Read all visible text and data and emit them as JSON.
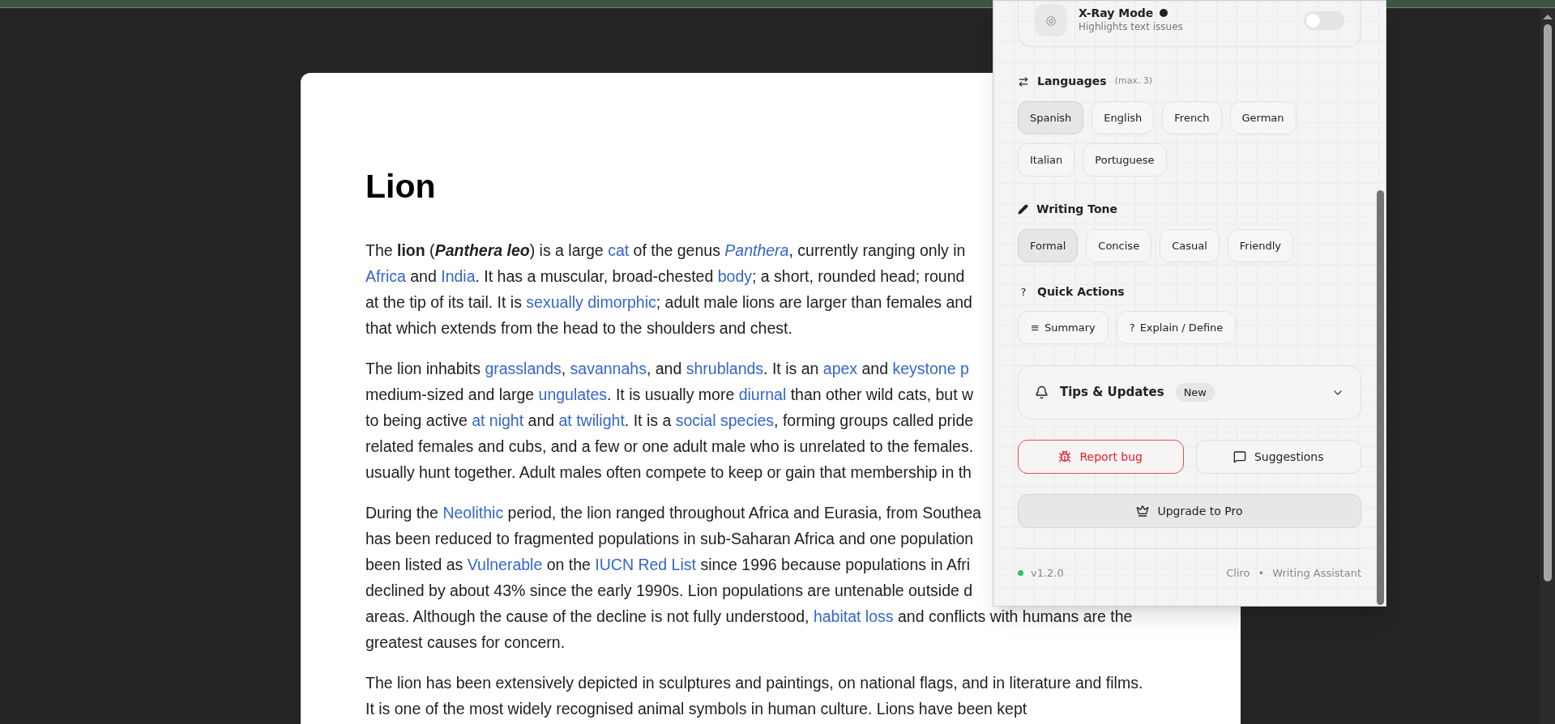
{
  "article": {
    "title": "Lion",
    "paragraphs": [
      {
        "lines": [
          [
            {
              "text": "The **lion** (",
              "link": false
            },
            {
              "text": "*Panthera leo*",
              "link": false,
              "bold": true
            },
            {
              "text": ") is a large ",
              "link": false
            },
            {
              "text": "cat",
              "link": true
            },
            {
              "text": " of the genus ",
              "link": false
            },
            {
              "text": "*Panthera*",
              "link": true
            },
            {
              "text": ", currently ranging only in",
              "link": false
            }
          ],
          [
            {
              "text": "Africa",
              "link": true
            },
            {
              "text": " and ",
              "link": false
            },
            {
              "text": "India",
              "link": true
            },
            {
              "text": ". It has a muscular, broad-chested ",
              "link": false
            },
            {
              "text": "body",
              "link": true
            },
            {
              "text": "; a short, rounded head; round",
              "link": false
            }
          ],
          [
            {
              "text": "at the tip of its tail. It is ",
              "link": false
            },
            {
              "text": "sexually dimorphic",
              "link": true
            },
            {
              "text": "; adult male lions are larger than females and",
              "link": false
            }
          ],
          [
            {
              "text": "that which extends from the head to the shoulders and chest.",
              "link": false
            }
          ]
        ]
      },
      {
        "lines": [
          [
            {
              "text": "The lion inhabits ",
              "link": false
            },
            {
              "text": "grasslands",
              "link": true
            },
            {
              "text": ", ",
              "link": false
            },
            {
              "text": "savannahs",
              "link": true
            },
            {
              "text": ", and ",
              "link": false
            },
            {
              "text": "shrublands",
              "link": true
            },
            {
              "text": ". It is an ",
              "link": false
            },
            {
              "text": "apex",
              "link": true
            },
            {
              "text": " and ",
              "link": false
            },
            {
              "text": "keystone p",
              "link": true
            }
          ],
          [
            {
              "text": "medium-sized and large ",
              "link": false
            },
            {
              "text": "ungulates",
              "link": true
            },
            {
              "text": ". It is usually more ",
              "link": false
            },
            {
              "text": "diurnal",
              "link": true
            },
            {
              "text": " than other wild cats, but w",
              "link": false
            }
          ],
          [
            {
              "text": "to being active ",
              "link": false
            },
            {
              "text": "at night",
              "link": true
            },
            {
              "text": " and ",
              "link": false
            },
            {
              "text": "at twilight",
              "link": true
            },
            {
              "text": ". It is a ",
              "link": false
            },
            {
              "text": "social species",
              "link": true
            },
            {
              "text": ", forming groups called pride",
              "link": false
            }
          ],
          [
            {
              "text": "related females and cubs, and a few or one adult male who is unrelated to the females.",
              "link": false
            }
          ],
          [
            {
              "text": "usually hunt together. Adult males often compete to keep or gain that membership in th",
              "link": false
            }
          ]
        ]
      },
      {
        "lines": [
          [
            {
              "text": "During the ",
              "link": false
            },
            {
              "text": "Neolithic",
              "link": true
            },
            {
              "text": " period, the lion ranged throughout Africa and Eurasia, from Southea",
              "link": false
            }
          ],
          [
            {
              "text": "has been reduced to fragmented populations in sub-Saharan Africa and one population",
              "link": false
            }
          ],
          [
            {
              "text": "been listed as ",
              "link": false
            },
            {
              "text": "Vulnerable",
              "link": true
            },
            {
              "text": " on the ",
              "link": false
            },
            {
              "text": "IUCN Red List",
              "link": true
            },
            {
              "text": " since 1996 because populations in Afri",
              "link": false
            }
          ],
          [
            {
              "text": "declined by about 43% since the early 1990s. Lion populations are untenable outside d",
              "link": false
            }
          ],
          [
            {
              "text": "areas. Although the cause of the decline is not fully understood, ",
              "link": false
            },
            {
              "text": "habitat loss",
              "link": true
            },
            {
              "text": " and conflicts with humans are the",
              "link": false
            }
          ],
          [
            {
              "text": "greatest causes for concern.",
              "link": false
            }
          ]
        ]
      },
      {
        "lines": [
          [
            {
              "text": "The lion has been extensively depicted in sculptures and paintings, on national flags, and in literature and films.",
              "link": false
            }
          ],
          [
            {
              "text": "It is one of the most widely recognised animal symbols in human culture. Lions have been kept",
              "link": false
            }
          ]
        ]
      }
    ]
  },
  "panel": {
    "xray": {
      "icon": "◎",
      "title": "X-Ray Mode",
      "subtitle": "Highlights text issues",
      "on": false
    },
    "languages": {
      "title": "Languages",
      "note": "(max. 3)",
      "options": [
        {
          "label": "Spanish",
          "selected": true
        },
        {
          "label": "English",
          "selected": false
        },
        {
          "label": "French",
          "selected": false
        },
        {
          "label": "German",
          "selected": false
        },
        {
          "label": "Italian",
          "selected": false
        },
        {
          "label": "Portuguese",
          "selected": false
        }
      ]
    },
    "tone": {
      "title": "Writing Tone",
      "options": [
        {
          "label": "Formal",
          "selected": true
        },
        {
          "label": "Concise",
          "selected": false
        },
        {
          "label": "Casual",
          "selected": false
        },
        {
          "label": "Friendly",
          "selected": false
        }
      ]
    },
    "quick_actions": {
      "icon": "?",
      "title": "Quick Actions",
      "actions": [
        {
          "icon": "≡",
          "label": "Summary"
        },
        {
          "icon": "?",
          "label": "Explain / Define"
        }
      ]
    },
    "tips": {
      "title": "Tips & Updates",
      "badge": "New",
      "expanded": false
    },
    "buttons": [
      {
        "kind": "danger",
        "label": "Report bug"
      },
      {
        "kind": "plain",
        "label": "Suggestions"
      }
    ],
    "upgrade": {
      "label": "Upgrade to Pro"
    },
    "footer": {
      "version": "v1.2.0",
      "online": true,
      "brand": "Cliro",
      "separator": "•",
      "tagline": "Writing Assistant"
    }
  }
}
